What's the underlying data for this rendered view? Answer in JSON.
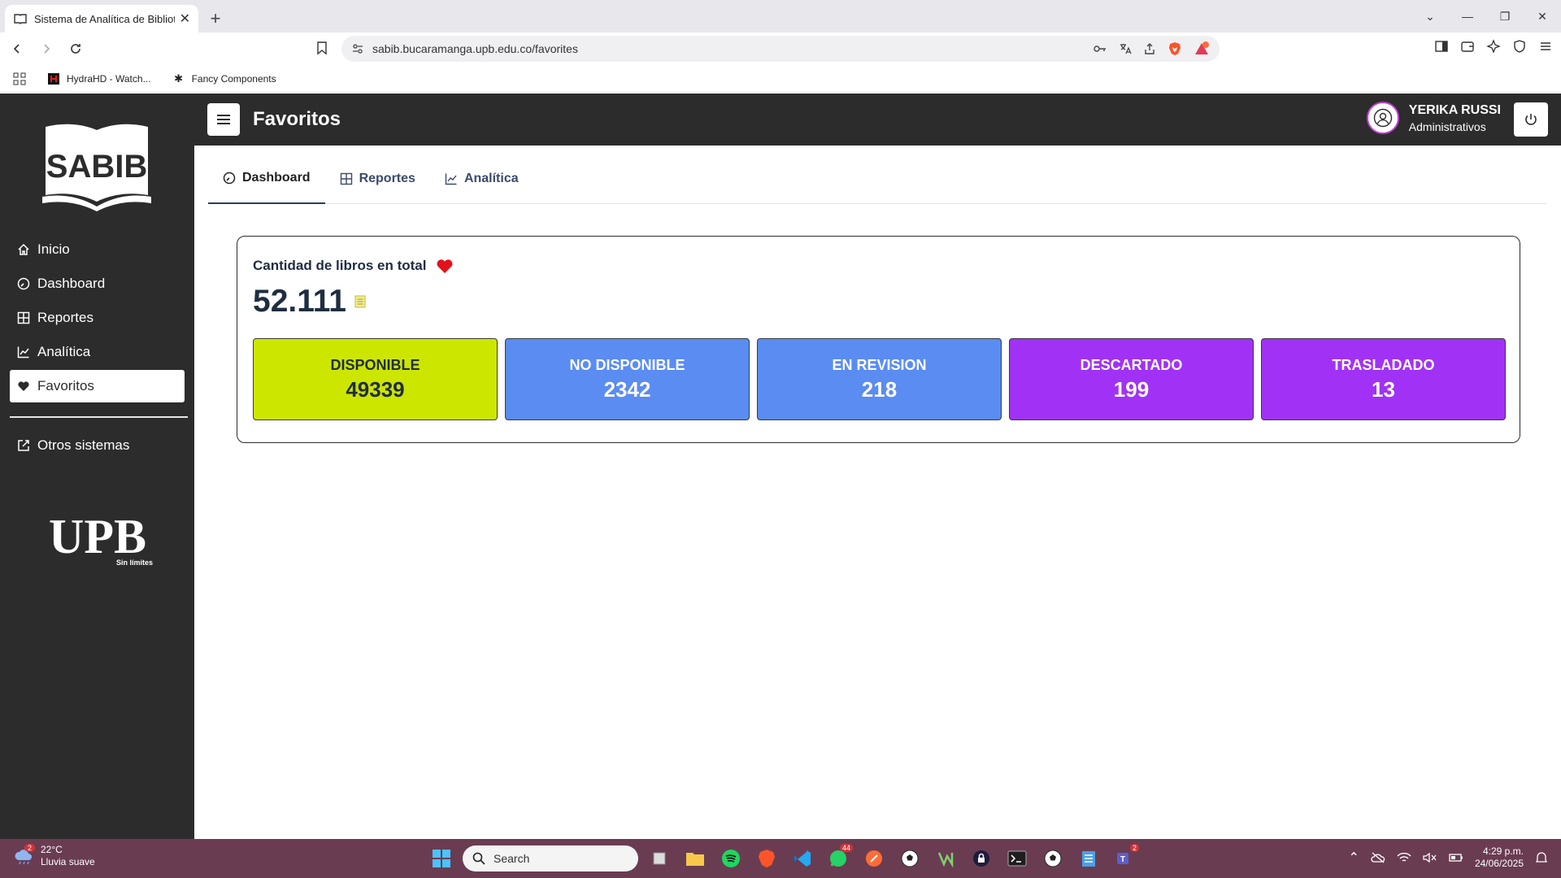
{
  "browser": {
    "tab_title": "Sistema de Analítica de Bibliotec",
    "url": "sabib.bucaramanga.upb.edu.co/favorites",
    "bookmarks": [
      "HydraHD - Watch...",
      "Fancy Components"
    ]
  },
  "sidebar": {
    "logo_text": "SABIB",
    "items": [
      {
        "label": "Inicio",
        "icon": "home-icon"
      },
      {
        "label": "Dashboard",
        "icon": "gauge-icon"
      },
      {
        "label": "Reportes",
        "icon": "table-icon"
      },
      {
        "label": "Analítica",
        "icon": "chart-line-icon"
      },
      {
        "label": "Favoritos",
        "icon": "heart-icon",
        "active": true
      }
    ],
    "other_systems": "Otros sistemas",
    "footer_logo_text": "UPB",
    "footer_logo_tagline": "Sin límites"
  },
  "header": {
    "title": "Favoritos",
    "user_name": "YERIKA RUSSI",
    "user_role": "Administrativos"
  },
  "tabs": [
    {
      "label": "Dashboard",
      "active": true
    },
    {
      "label": "Reportes",
      "active": false
    },
    {
      "label": "Analítica",
      "active": false
    }
  ],
  "card": {
    "title": "Cantidad de libros en total",
    "total": "52.111",
    "statuses": [
      {
        "label": "DISPONIBLE",
        "value": "49339",
        "color": "#cde600",
        "text_color": "#1f2d40"
      },
      {
        "label": "NO DISPONIBLE",
        "value": "2342",
        "color": "#5a8cf2",
        "text_color": "#ffffff"
      },
      {
        "label": "EN REVISION",
        "value": "218",
        "color": "#5a8cf2",
        "text_color": "#ffffff"
      },
      {
        "label": "DESCARTADO",
        "value": "199",
        "color": "#a132f5",
        "text_color": "#ffffff"
      },
      {
        "label": "TRASLADADO",
        "value": "13",
        "color": "#a132f5",
        "text_color": "#ffffff"
      }
    ]
  },
  "taskbar": {
    "weather_temp": "22°C",
    "weather_desc": "Lluvia suave",
    "weather_badge": "2",
    "search_placeholder": "Search",
    "whatsapp_badge": "44",
    "teams_badge": "2",
    "time": "4:29 p.m.",
    "date": "24/06/2025"
  }
}
